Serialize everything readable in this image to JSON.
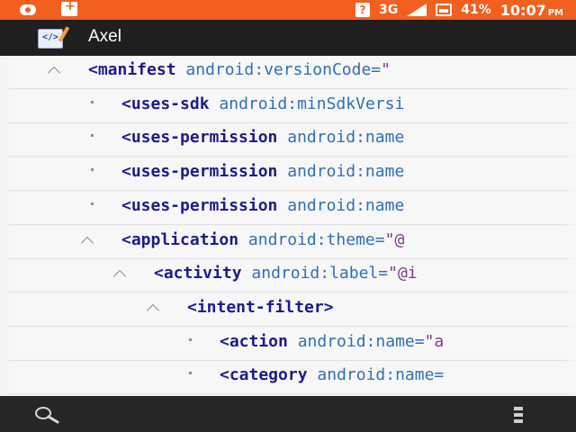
{
  "status_bar": {
    "network": "3G",
    "battery": "41%",
    "time": "10:07",
    "ampm": "PM"
  },
  "toolbar": {
    "icon": "xml-editor-icon",
    "title": "Axel"
  },
  "tree": [
    {
      "depth": 0,
      "expanded": true,
      "tag": "<manifest",
      "attr": "android:versionCode=",
      "val": "\""
    },
    {
      "depth": 1,
      "expanded": null,
      "tag": "<uses-sdk",
      "attr": "android:minSdkVersi",
      "val": ""
    },
    {
      "depth": 1,
      "expanded": null,
      "tag": "<uses-permission",
      "attr": "android:name",
      "val": ""
    },
    {
      "depth": 1,
      "expanded": null,
      "tag": "<uses-permission",
      "attr": "android:name",
      "val": ""
    },
    {
      "depth": 1,
      "expanded": null,
      "tag": "<uses-permission",
      "attr": "android:name",
      "val": ""
    },
    {
      "depth": 1,
      "expanded": true,
      "tag": "<application",
      "attr": "android:theme=",
      "val": "\"@"
    },
    {
      "depth": 2,
      "expanded": true,
      "tag": "<activity",
      "attr": "android:label=",
      "val": "\"@i"
    },
    {
      "depth": 3,
      "expanded": true,
      "tag": "<intent-filter>",
      "attr": "",
      "val": ""
    },
    {
      "depth": 4,
      "expanded": null,
      "tag": "<action",
      "attr": "android:name=",
      "val": "\"a"
    },
    {
      "depth": 4,
      "expanded": null,
      "tag": "<category",
      "attr": "android:name=",
      "val": ""
    }
  ],
  "bottom_bar": {
    "left_icon": "search-icon",
    "right_icon": "overflow-menu-icon"
  },
  "colors": {
    "status_bar": "#f25f1f",
    "toolbar": "#1f1f1f",
    "tag": "#1d1b8c",
    "attribute": "#2f6fb4",
    "value": "#7a3a8e"
  }
}
